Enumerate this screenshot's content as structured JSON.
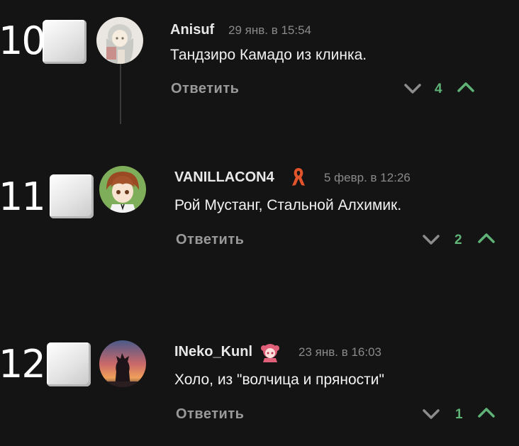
{
  "comments": [
    {
      "rank": "10",
      "author": "Anisuf",
      "time": "29 янв. в 15:54",
      "text": "Тандзиро Камадо из клинка.",
      "reply_label": "Ответить",
      "votes": "4",
      "avatar_icon": "anime-girl-avatar"
    },
    {
      "rank": "11",
      "author": "VANILLACON4",
      "time": "5 февр. в 12:26",
      "text": "Рой Мустанг, Стальной Алхимик.",
      "reply_label": "Ответить",
      "votes": "2",
      "avatar_icon": "anime-boy-avatar",
      "badge_icon": "ribbon-icon"
    },
    {
      "rank": "12",
      "author": "INeko_Kunl",
      "time": "23 янв. в 16:03",
      "text": "Холо, из \"волчица и пряности\"",
      "reply_label": "Ответить",
      "votes": "1",
      "avatar_icon": "sunset-silhouette-avatar",
      "badge_icon": "anime-girl-badge-icon"
    }
  ],
  "colors": {
    "background": "#141414",
    "upvote": "#5fb377",
    "downvote": "#8c8c8c",
    "ribbon": "#e2542b"
  }
}
